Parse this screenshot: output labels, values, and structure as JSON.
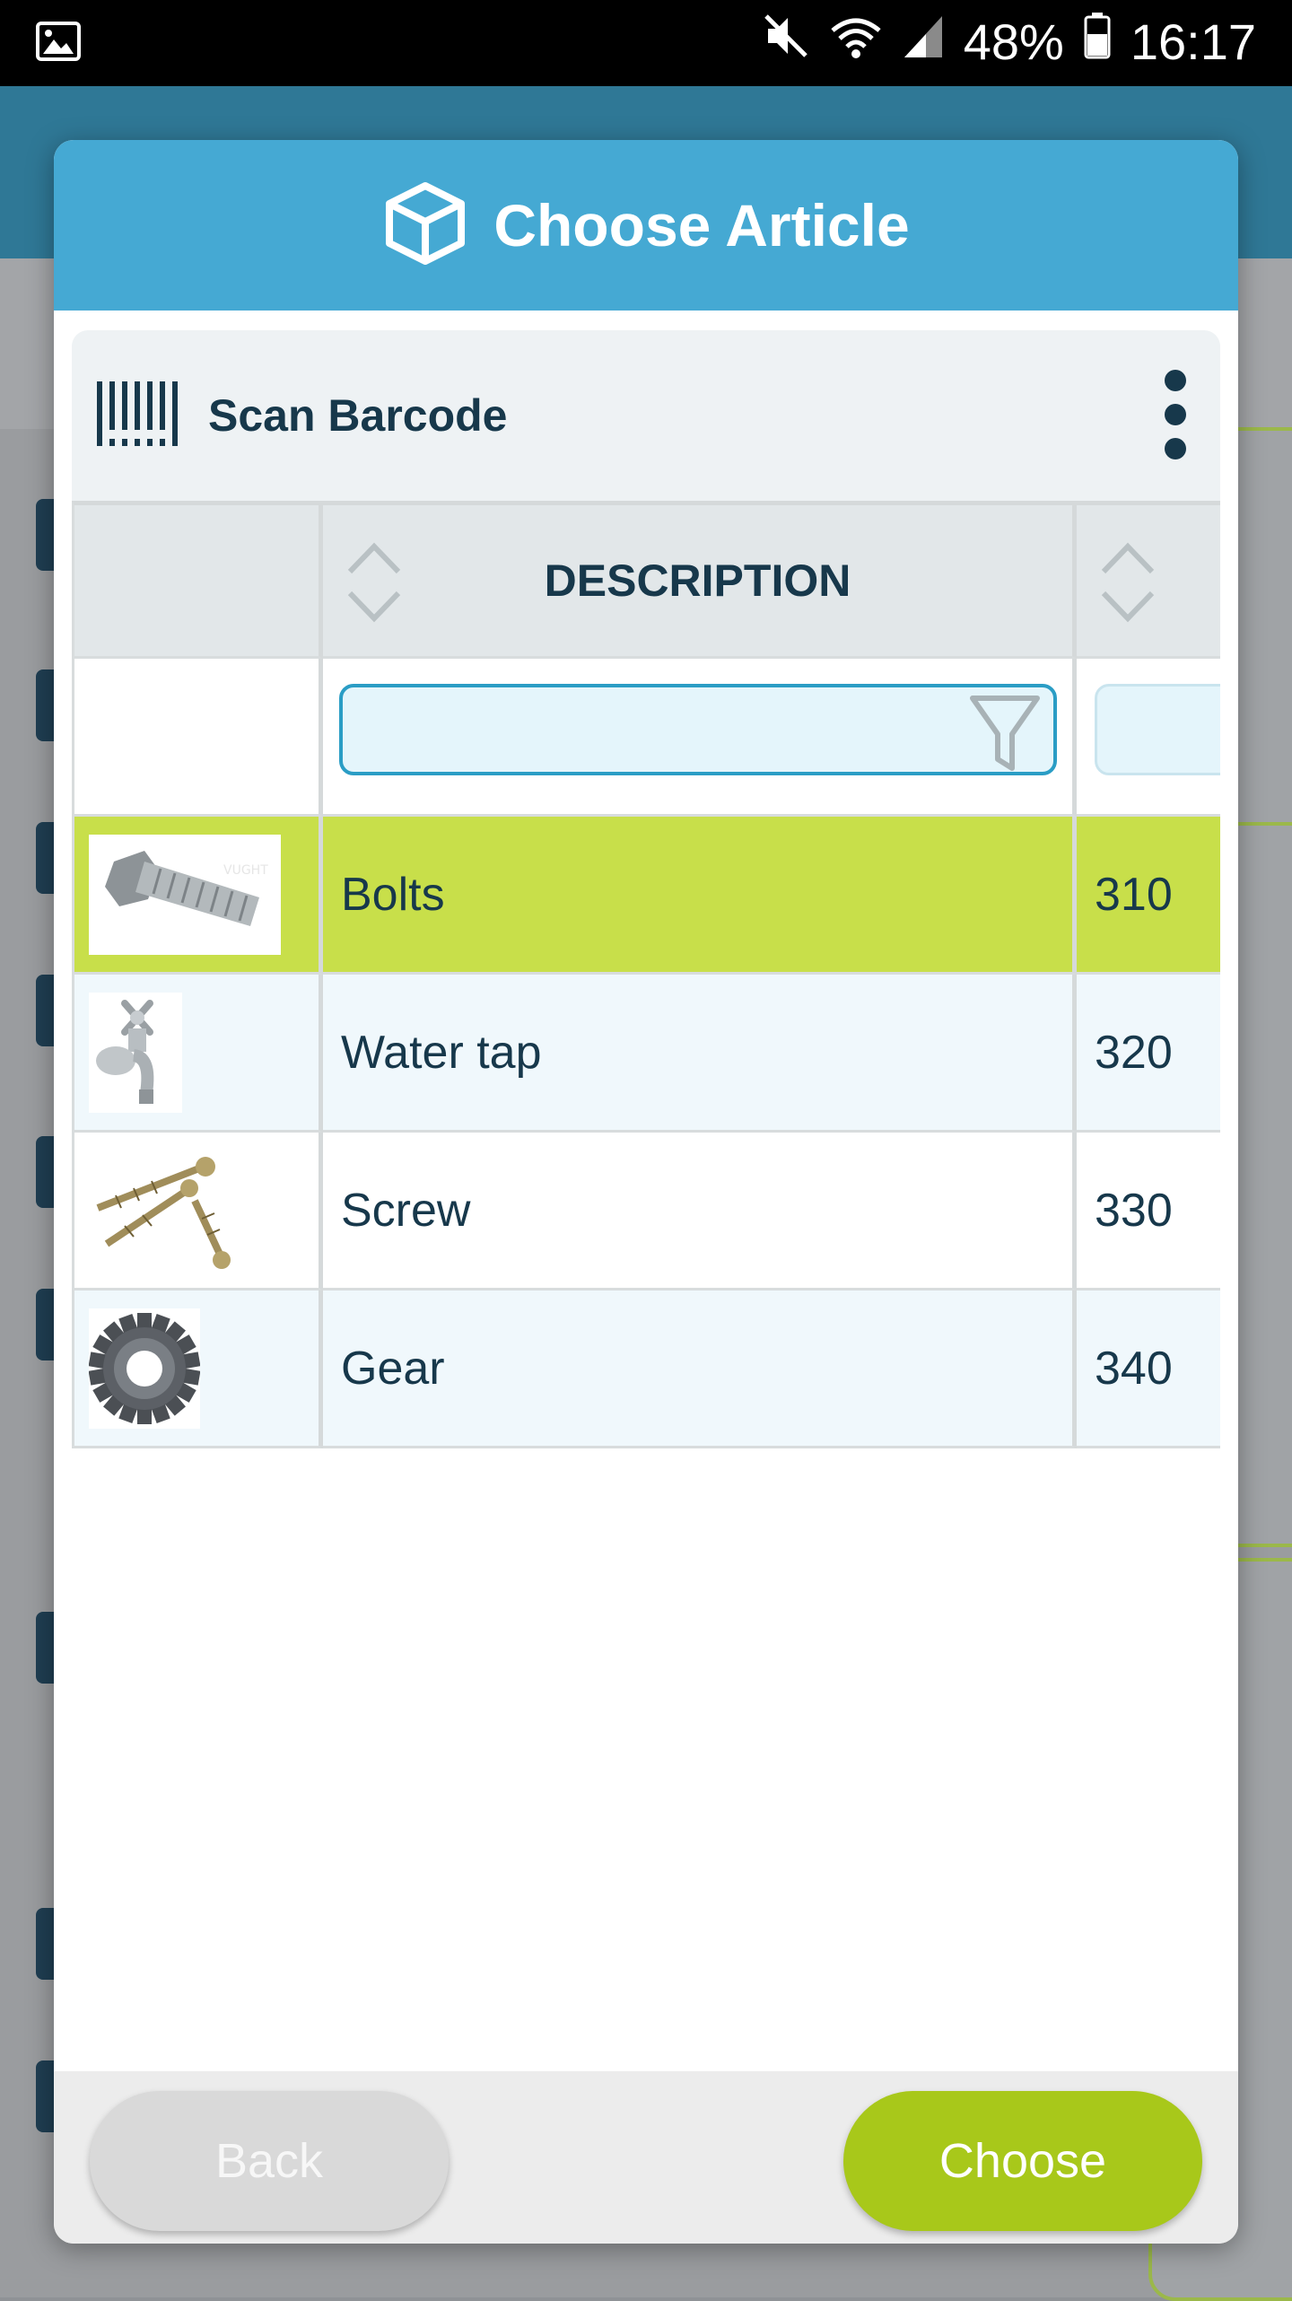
{
  "status_bar": {
    "battery": "48%",
    "time": "16:17"
  },
  "dialog": {
    "title": "Choose Article",
    "scan_label": "Scan Barcode",
    "table": {
      "column_header": "DESCRIPTION",
      "rows": [
        {
          "description": "Bolts",
          "code": "310",
          "image": "bolt-image"
        },
        {
          "description": "Water tap",
          "code": "320",
          "image": "water-tap-image"
        },
        {
          "description": "Screw",
          "code": "330",
          "image": "screw-image"
        },
        {
          "description": "Gear",
          "code": "340",
          "image": "gear-image"
        }
      ]
    },
    "back_label": "Back",
    "choose_label": "Choose"
  },
  "colors": {
    "header": "#45a9d3",
    "selected_row": "#c8df4a",
    "choose_button": "#a8c81a",
    "text_dark": "#17384b"
  }
}
